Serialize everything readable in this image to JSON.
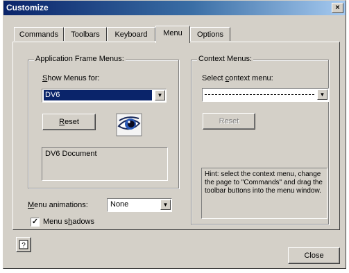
{
  "window": {
    "title": "Customize",
    "close_glyph": "×"
  },
  "tabs": [
    {
      "label": "Commands"
    },
    {
      "label": "Toolbars"
    },
    {
      "label": "Keyboard"
    },
    {
      "label": "Menu",
      "active": true
    },
    {
      "label": "Options"
    }
  ],
  "app_frame": {
    "group_label": "Application Frame Menus:",
    "show_menus_prefix": "S",
    "show_menus_rest": "how Menus for:",
    "show_menus_value": "DV6",
    "reset_prefix": "R",
    "reset_rest": "eset",
    "description": "DV6 Document",
    "icon": "eye-icon"
  },
  "context": {
    "group_label": "Context Menus:",
    "select_prefix": "Select ",
    "select_u": "c",
    "select_rest": "ontext menu:",
    "select_value": "",
    "reset_label": "Reset",
    "hint": "Hint: select the context menu, change the page to \"Commands\" and drag the toolbar buttons into the menu window."
  },
  "menu_animations": {
    "label_prefix": "M",
    "label_rest": "enu animations:",
    "value": "None"
  },
  "menu_shadows": {
    "label_pre": "Menu s",
    "label_u": "h",
    "label_rest": "adows",
    "checked": true,
    "check_glyph": "✓"
  },
  "footer": {
    "help_icon": "help-icon",
    "close_label": "Close"
  },
  "colors": {
    "title_start": "#0a246a",
    "title_end": "#a6caf0",
    "face": "#d4d0c8",
    "selection": "#0a246a"
  }
}
